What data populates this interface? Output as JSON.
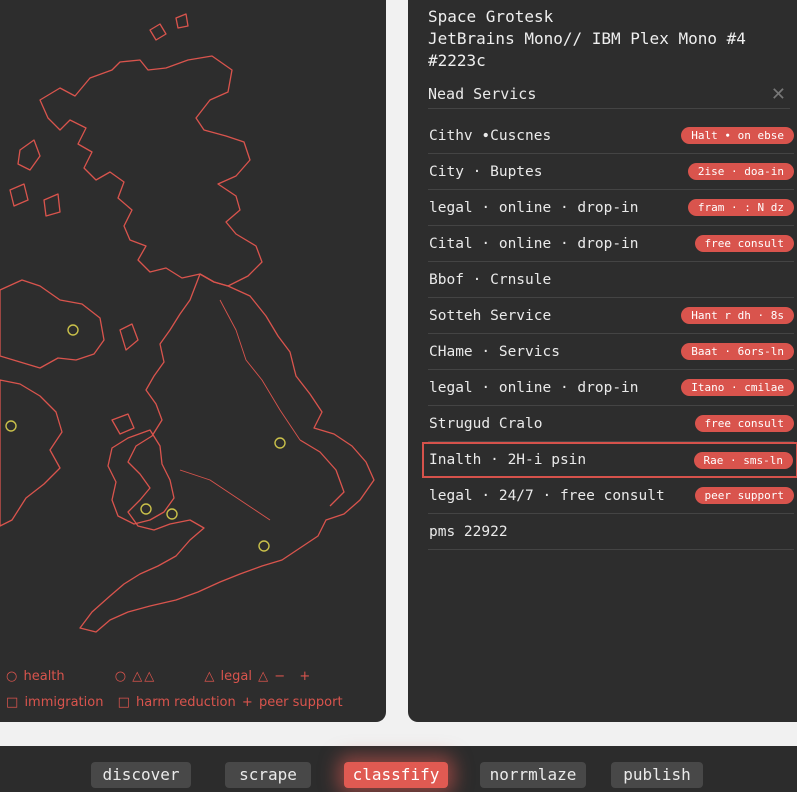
{
  "header": {
    "line1": "Space Grotesk",
    "line2": "JetBrains Mono// IBM Plex Mono #4",
    "line3": "#2223c"
  },
  "list": {
    "title": "Nead Servics",
    "close_icon": "close-icon",
    "rows": [
      {
        "name": "Cithv ∙Cuscnes",
        "tag": "Halt ∙ on ebse"
      },
      {
        "name": "City · Buptes",
        "tag": "2ise · doa-in"
      },
      {
        "name": "legal · online · drop-in",
        "tag": "fram · : N dz"
      },
      {
        "name": "Cital · online · drop-in",
        "tag": "free consult"
      },
      {
        "name": "Bbof · Crnsule",
        "tag": ""
      },
      {
        "name": "Sotteh Service",
        "tag": "Hant r dh · 8s"
      },
      {
        "name": "CHame · Servics",
        "tag": "Baat · 6ors-ln"
      },
      {
        "name": "legal · online · drop-in",
        "tag": "Itano · cmilae"
      },
      {
        "name": "Strugud Cralo",
        "tag": "free consult"
      },
      {
        "name": "Inalth · 2H-i psin",
        "tag": "Rae · sms-ln",
        "selected": true
      },
      {
        "name": "legal · 24/7 · free consult",
        "tag": "peer support"
      },
      {
        "name": "pms 22922",
        "tag": ""
      }
    ]
  },
  "legend": {
    "health": "health",
    "legal": "legal",
    "immigration": "immigration",
    "harm_reduction": "harm reduction",
    "peer_support": "peer support",
    "minus": "−",
    "plus": "+"
  },
  "nav": {
    "items": [
      {
        "label": "discover",
        "active": false
      },
      {
        "label": "scrape",
        "active": false
      },
      {
        "label": "classfify",
        "active": true
      },
      {
        "label": "norrmlaze",
        "active": false
      },
      {
        "label": "publish",
        "active": false
      }
    ]
  },
  "colors": {
    "accent": "#d9544d",
    "panel": "#2d2d2d",
    "marker": "#c9c04a"
  }
}
